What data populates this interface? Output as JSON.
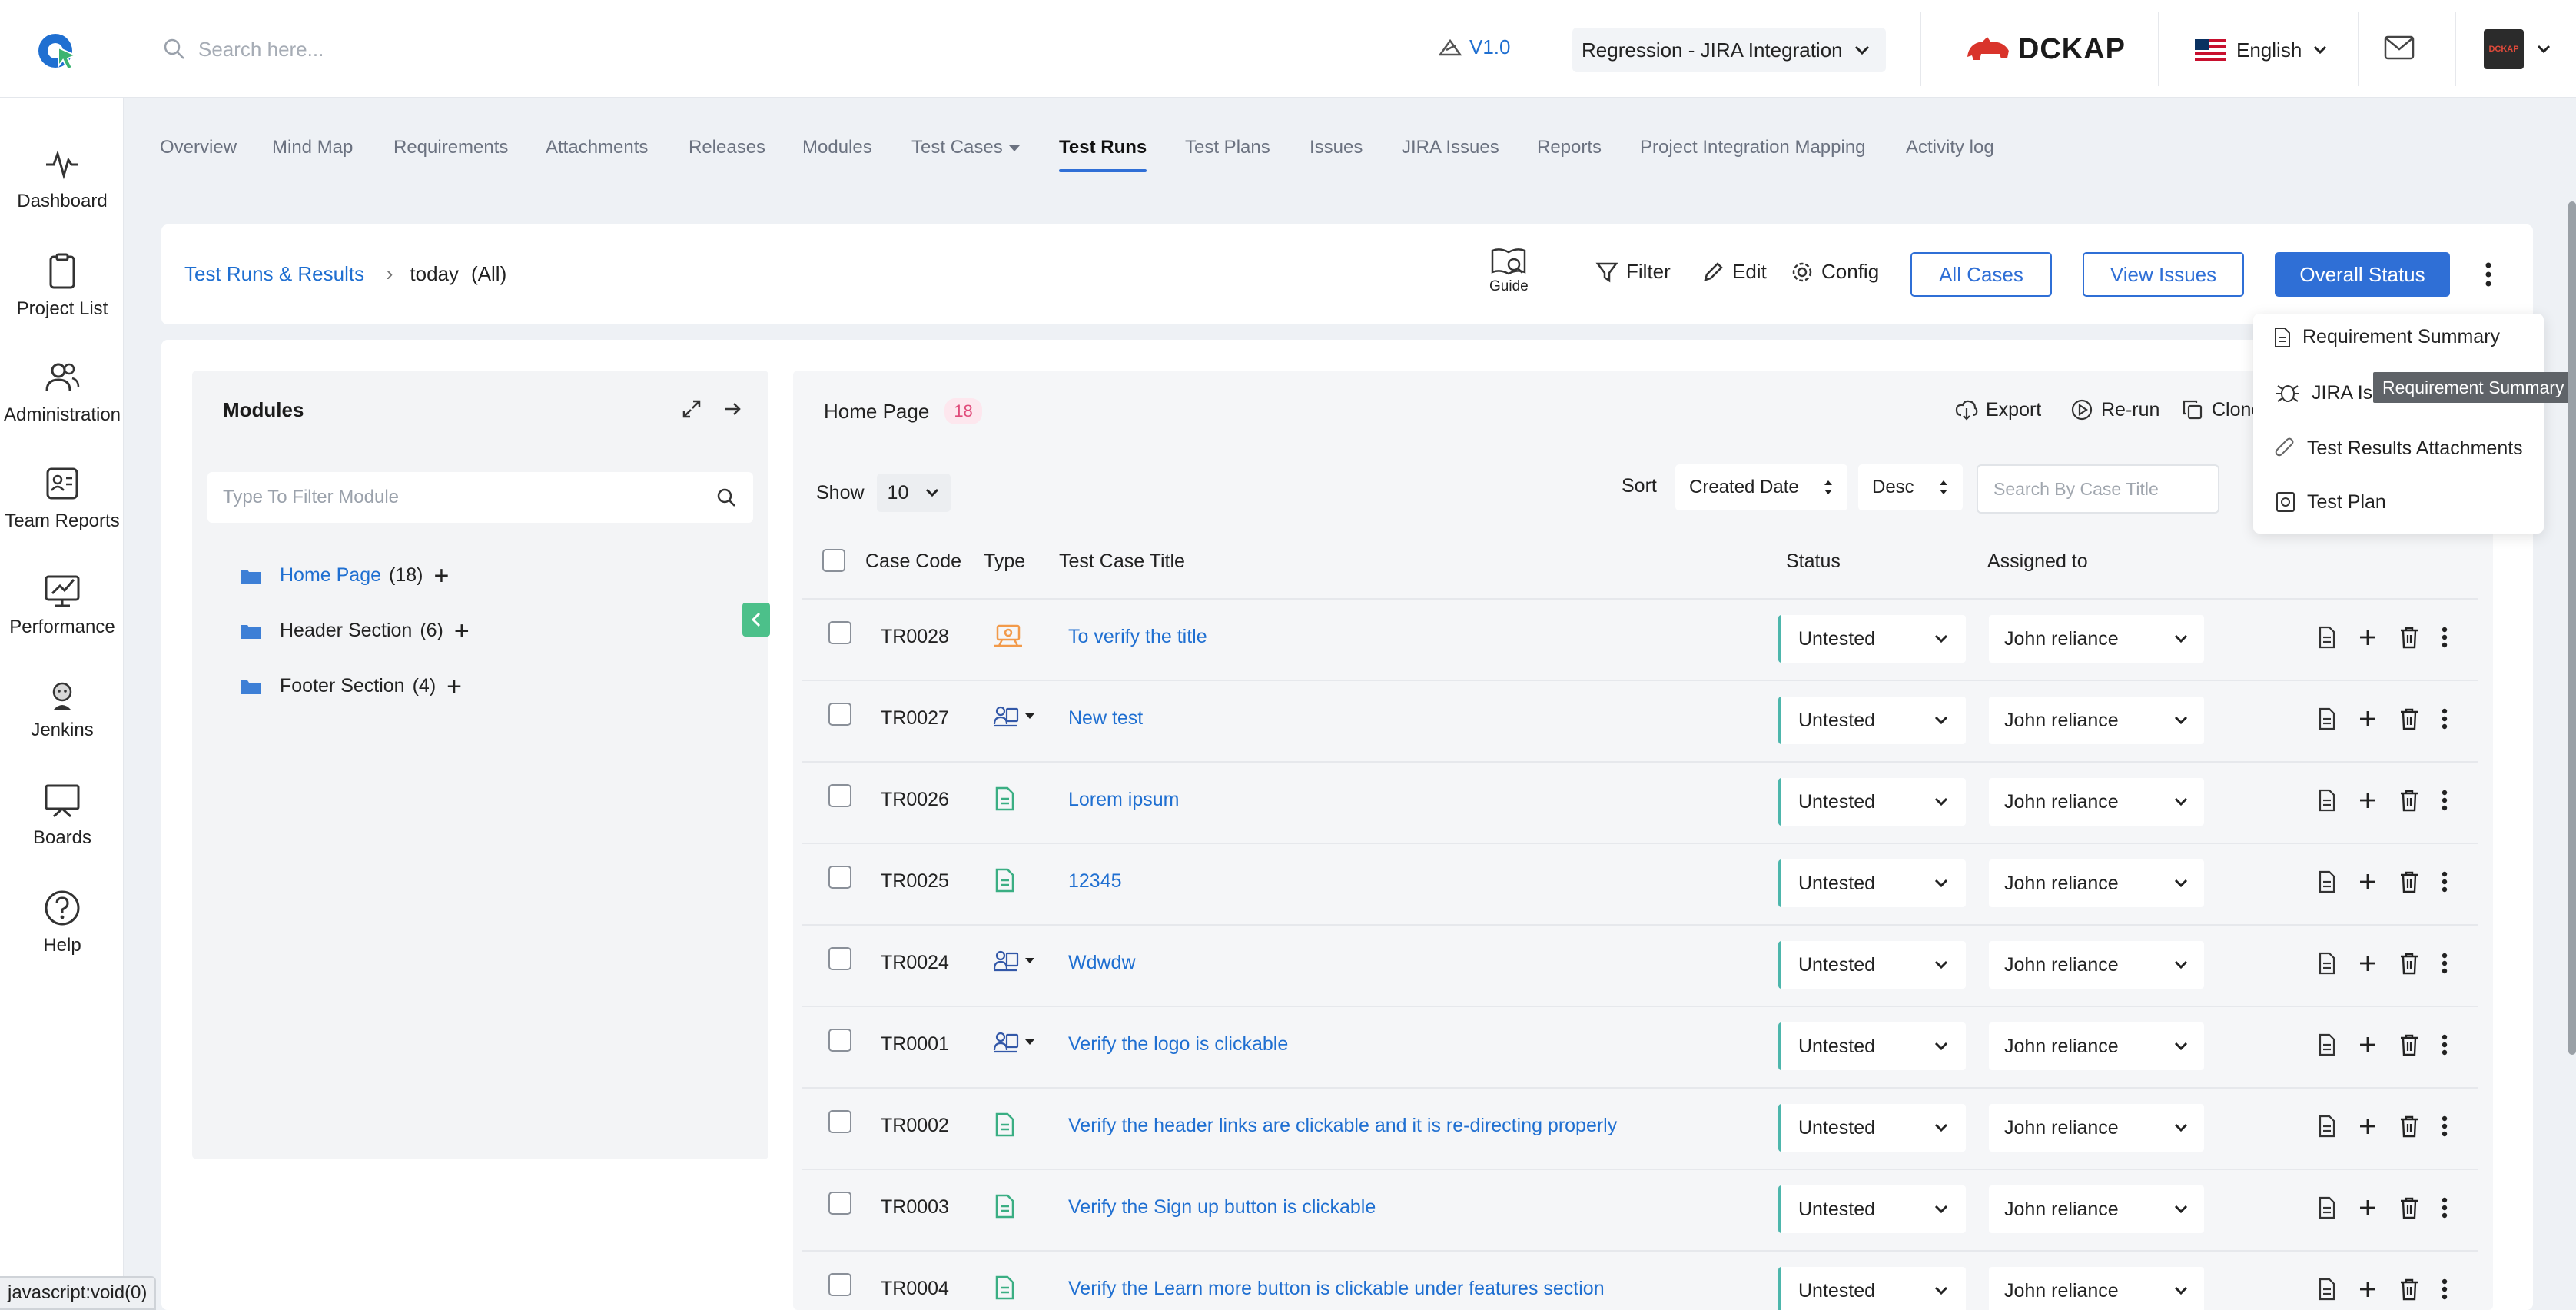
{
  "topbar": {
    "search_placeholder": "Search here...",
    "version": "V1.0",
    "project": "Regression - JIRA Integration",
    "brand": "DCKAP",
    "language": "English"
  },
  "sidenav": [
    {
      "label": "Dashboard",
      "icon": "pulse-icon"
    },
    {
      "label": "Project List",
      "icon": "clipboard-icon"
    },
    {
      "label": "Administration",
      "icon": "users-icon"
    },
    {
      "label": "Team Reports",
      "icon": "report-icon"
    },
    {
      "label": "Performance",
      "icon": "performance-icon"
    },
    {
      "label": "Jenkins",
      "icon": "jenkins-icon"
    },
    {
      "label": "Boards",
      "icon": "board-icon"
    },
    {
      "label": "Help",
      "icon": "help-icon"
    }
  ],
  "tabs": [
    "Overview",
    "Mind Map",
    "Requirements",
    "Attachments",
    "Releases",
    "Modules",
    "Test Cases",
    "Test Runs",
    "Test Plans",
    "Issues",
    "JIRA Issues",
    "Reports",
    "Project Integration Mapping",
    "Activity log"
  ],
  "active_tab": "Test Runs",
  "breadcrumb": {
    "root": "Test Runs & Results",
    "current": "today",
    "scope": "(All)"
  },
  "toolbar": {
    "guide": "Guide",
    "filter": "Filter",
    "edit": "Edit",
    "config": "Config",
    "all_cases": "All Cases",
    "view_issues": "View Issues",
    "overall_status": "Overall Status"
  },
  "modules": {
    "title": "Modules",
    "filter_placeholder": "Type To Filter Module",
    "items": [
      {
        "name": "Home Page",
        "count": "(18)"
      },
      {
        "name": "Header Section",
        "count": "(6)"
      },
      {
        "name": "Footer Section",
        "count": "(4)"
      }
    ]
  },
  "cases": {
    "module": "Home Page",
    "count": "18",
    "export": "Export",
    "rerun": "Re-run",
    "clone": "Clone",
    "show_label": "Show",
    "show_value": "10",
    "sort_label": "Sort",
    "sort_field": "Created Date",
    "sort_order": "Desc",
    "search_placeholder": "Search By Case Title",
    "columns": [
      "Case Code",
      "Type",
      "Test Case Title",
      "Status",
      "Assigned to"
    ],
    "rows": [
      {
        "code": "TR0028",
        "type": "automation",
        "title": "To verify the title",
        "status": "Untested",
        "assignee": "John reliance"
      },
      {
        "code": "TR0027",
        "type": "manual-dropdown",
        "title": "New test",
        "status": "Untested",
        "assignee": "John reliance"
      },
      {
        "code": "TR0026",
        "type": "document",
        "title": "Lorem ipsum",
        "status": "Untested",
        "assignee": "John reliance"
      },
      {
        "code": "TR0025",
        "type": "document",
        "title": "12345",
        "status": "Untested",
        "assignee": "John reliance"
      },
      {
        "code": "TR0024",
        "type": "manual-dropdown",
        "title": "Wdwdw",
        "status": "Untested",
        "assignee": "John reliance"
      },
      {
        "code": "TR0001",
        "type": "manual-dropdown",
        "title": "Verify the logo is clickable",
        "status": "Untested",
        "assignee": "John reliance"
      },
      {
        "code": "TR0002",
        "type": "document",
        "title": "Verify the header links are clickable and it is re-directing properly",
        "status": "Untested",
        "assignee": "John reliance"
      },
      {
        "code": "TR0003",
        "type": "document",
        "title": "Verify the Sign up button is clickable",
        "status": "Untested",
        "assignee": "John reliance"
      },
      {
        "code": "TR0004",
        "type": "document",
        "title": "Verify the Learn more button is clickable under features section",
        "status": "Untested",
        "assignee": "John reliance"
      }
    ]
  },
  "dropdown_menu": [
    "Requirement Summary",
    "JIRA Issues",
    "Test Results Attachments",
    "Test Plan"
  ],
  "dropdown_jira_visible": "JIRA Is",
  "tooltip": "Requirement Summary",
  "status_bar": "javascript:void(0)",
  "colors": {
    "primary": "#2f6fd6",
    "link": "#1f6fd1",
    "accent_green": "#4cc08a",
    "status_border": "#4db6ac",
    "badge_pink": "#e04b7a"
  }
}
